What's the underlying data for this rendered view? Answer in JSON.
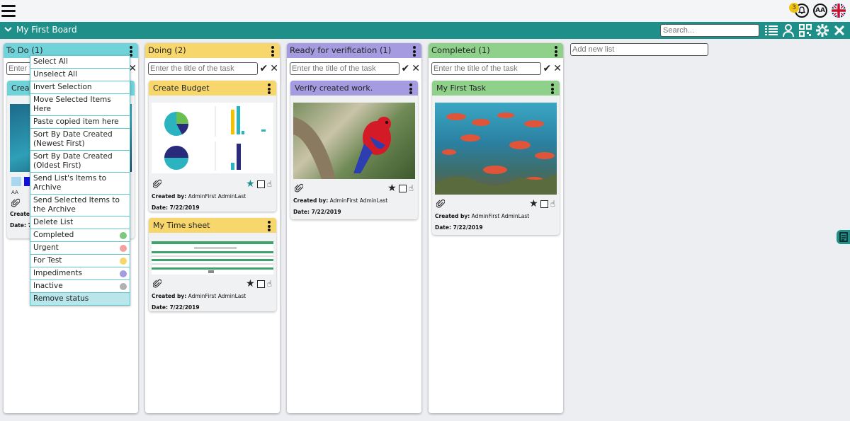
{
  "header": {
    "notification_count": "3",
    "font_size_label": "AA"
  },
  "board": {
    "title": "My First Board",
    "search_placeholder": "Search...",
    "add_list_placeholder": "Add new list"
  },
  "lists": [
    {
      "title": "To Do",
      "count": "(1)",
      "color": "#6fd3d9",
      "task_placeholder": "Enter the title of the task",
      "card": {
        "title_partial": "Create",
        "meta_partial": "Created",
        "date_partial": "Date: 7/",
        "aa": "AA"
      }
    },
    {
      "title": "Doing",
      "count": "(2)",
      "color": "#f7d76b",
      "task_placeholder": "Enter the title of the task",
      "cards": [
        {
          "title": "Create Budget",
          "created_by_label": "Created by:",
          "created_by": "AdminFirst AdminLast",
          "date": "Date: 7/22/2019"
        },
        {
          "title": "My Time sheet",
          "created_by_label": "Created by:",
          "created_by": "AdminFirst AdminLast",
          "date": "Date: 7/22/2019"
        }
      ]
    },
    {
      "title": "Ready for verification",
      "count": "(1)",
      "color": "#a49be0",
      "task_placeholder": "Enter the title of the task",
      "cards": [
        {
          "title": "Verify created work.",
          "created_by_label": "Created by:",
          "created_by": "AdminFirst AdminLast",
          "date": "Date: 7/22/2019"
        }
      ]
    },
    {
      "title": "Completed",
      "count": "(1)",
      "color": "#8fd18a",
      "task_placeholder": "Enter the title of the task",
      "cards": [
        {
          "title": "My First Task",
          "created_by_label": "Created by:",
          "created_by": "AdminFirst AdminLast",
          "date": "Date: 7/22/2019"
        }
      ]
    }
  ],
  "menu": {
    "items": [
      "Select All",
      "Unselect All",
      "Invert Selection",
      "Move Selected Items Here",
      "Paste copied item here",
      "Sort By Date Created (Newest First)",
      "Sort By Date Created (Oldest First)",
      "Send List's Items to Archive",
      "Send Selected Items to the Archive",
      "Delete List"
    ],
    "statuses": [
      {
        "label": "Completed",
        "color": "#7dc87a"
      },
      {
        "label": "Urgent",
        "color": "#f2a0a0"
      },
      {
        "label": "For Test",
        "color": "#f7d76b"
      },
      {
        "label": "Impediments",
        "color": "#a49be0"
      },
      {
        "label": "Inactive",
        "color": "#b0b0b0"
      }
    ],
    "remove_status": "Remove status"
  },
  "icons": [
    "hamburger-icon",
    "bell-icon",
    "font-size-icon",
    "uk-flag-icon",
    "chevron-down-icon",
    "list-view-icon",
    "user-icon",
    "qr-icon",
    "gear-icon",
    "close-icon",
    "kebab-icon",
    "check-icon",
    "x-icon",
    "paperclip-icon",
    "star-icon",
    "checkbox-icon",
    "hand-icon",
    "notes-icon"
  ]
}
